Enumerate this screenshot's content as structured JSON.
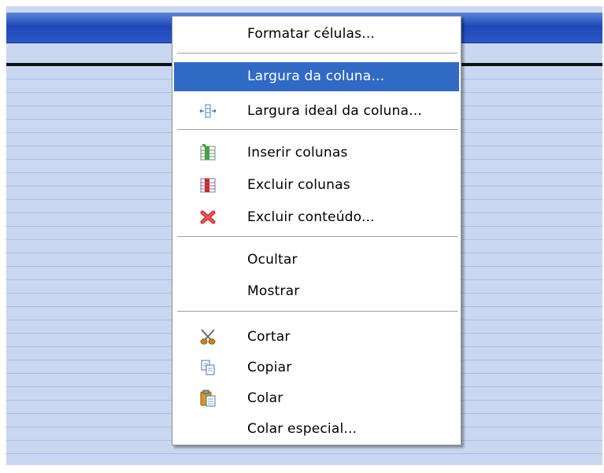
{
  "menu": {
    "items": [
      {
        "label": "Formatar células...",
        "icon": ""
      },
      {
        "label": "Largura da coluna...",
        "icon": "",
        "highlighted": true
      },
      {
        "label": "Largura ideal da coluna...",
        "icon": "optimal-width-icon"
      },
      {
        "label": "Inserir colunas",
        "icon": "insert-columns-icon"
      },
      {
        "label": "Excluir colunas",
        "icon": "delete-columns-icon"
      },
      {
        "label": "Excluir conteúdo...",
        "icon": "delete-contents-icon"
      },
      {
        "label": "Ocultar",
        "icon": ""
      },
      {
        "label": "Mostrar",
        "icon": ""
      },
      {
        "label": "Cortar",
        "icon": "scissors-icon"
      },
      {
        "label": "Copiar",
        "icon": "copy-icon"
      },
      {
        "label": "Colar",
        "icon": "paste-icon"
      },
      {
        "label": "Colar especial...",
        "icon": ""
      }
    ]
  },
  "colors": {
    "highlight": "#316ac5",
    "sheet_background": "#c9d7f1",
    "header_bar": "#2b58c6"
  }
}
